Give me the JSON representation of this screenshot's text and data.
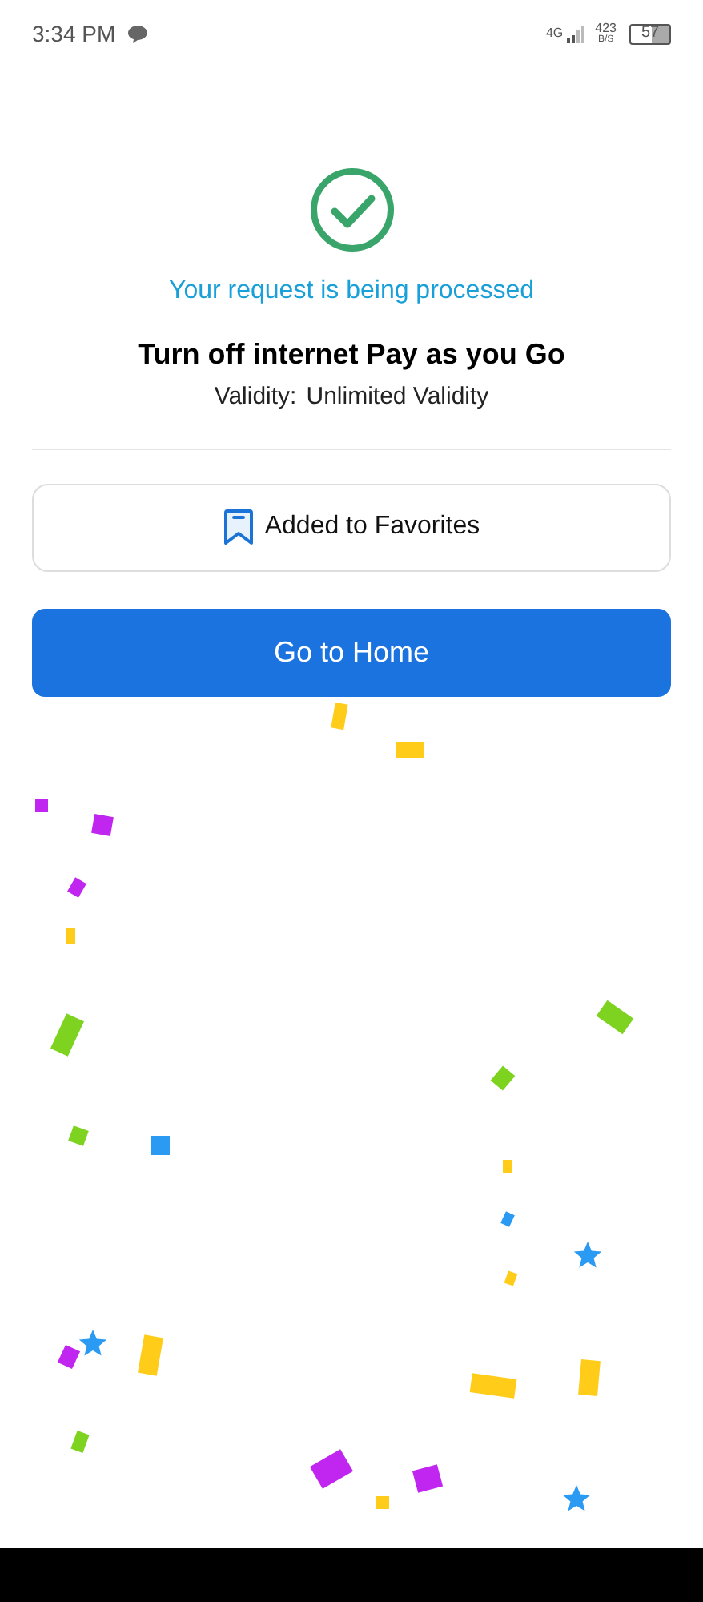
{
  "status_bar": {
    "time": "3:34 PM",
    "network": "4G",
    "speed": "423",
    "speed_unit": "B/S",
    "battery": "57"
  },
  "status_message": "Your request is being processed",
  "plan_title": "Turn off internet Pay as you Go",
  "validity": {
    "label": "Validity:",
    "value": "Unlimited Validity"
  },
  "favorite_button": {
    "label": "Added to Favorites",
    "selected": true
  },
  "home_button": {
    "label": "Go to Home"
  }
}
